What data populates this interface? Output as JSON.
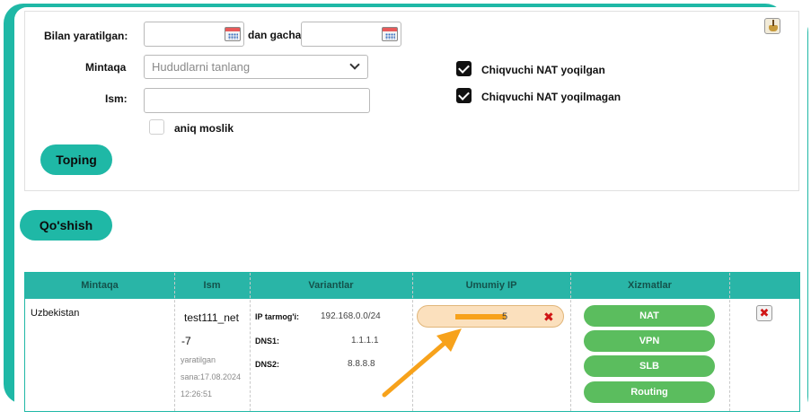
{
  "filter": {
    "created_label": "Bilan yaratilgan:",
    "until_label": "dan gacha",
    "region_label": "Mintaqa",
    "region_placeholder": "Hududlarni tanlang",
    "name_label": "Ism:",
    "exact_label": "aniq moslik",
    "nat_enabled_label": "Chiqvuchi NAT yoqilgan",
    "nat_disabled_label": "Chiqvuchi NAT yoqilmagan",
    "find_button": "Toping"
  },
  "add_button": "Qo'shish",
  "table": {
    "columns": [
      "Mintaqa",
      "Ism",
      "Variantlar",
      "Umumiy IP",
      "Xizmatlar"
    ],
    "rows": [
      {
        "region": "Uzbekistan",
        "name_line1": "test111_net",
        "name_line2": "-7",
        "created_line1": "yaratilgan",
        "created_line2": "sana:17.08.2024",
        "created_line3": "12:26:51",
        "ip_network_label": "IP tarmog'i:",
        "ip_network_value": "192.168.0.0/24",
        "dns1_label": "DNS1:",
        "dns1_value": "1.1.1.1",
        "dns2_label": "DNS2:",
        "dns2_value": "8.8.8.8",
        "public_ip_suffix": "5",
        "services": [
          "NAT",
          "VPN",
          "SLB",
          "Routing"
        ]
      }
    ]
  },
  "colors": {
    "accent": "#1fb8a6",
    "service_green": "#5bbd5e",
    "annotation_arrow": "#f7a21b",
    "delete_red": "#d01515"
  }
}
